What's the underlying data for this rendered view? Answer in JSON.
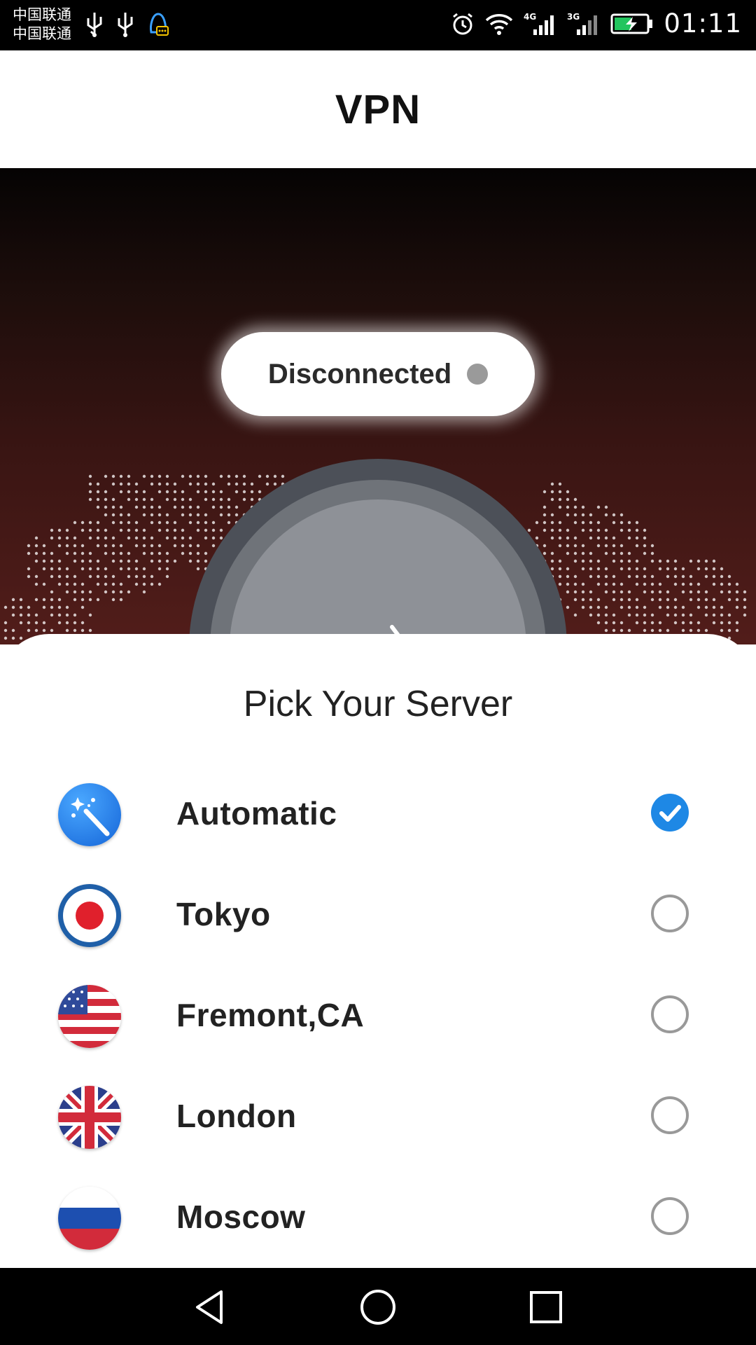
{
  "status_bar": {
    "carrier_1": "中国联通",
    "carrier_2": "中国联通",
    "time": "01:11",
    "icons_left": [
      "usb-icon",
      "usb-icon",
      "qq-notification-icon"
    ],
    "icons_right": [
      "alarm-icon",
      "wifi-icon",
      "signal-4g-icon",
      "signal-3g-icon",
      "battery-charging-icon"
    ]
  },
  "app_bar": {
    "title": "VPN"
  },
  "hero": {
    "status_text": "Disconnected",
    "status_color": "#9a9a9a",
    "power_icon": "power-icon"
  },
  "server_sheet": {
    "title": "Pick Your Server",
    "selected_index": 0,
    "servers": [
      {
        "name": "Automatic",
        "icon": "magic-wand-icon",
        "selected": true
      },
      {
        "name": "Tokyo",
        "icon": "japan-flag-icon",
        "selected": false
      },
      {
        "name": "Fremont,CA",
        "icon": "usa-flag-icon",
        "selected": false
      },
      {
        "name": "London",
        "icon": "uk-flag-icon",
        "selected": false
      },
      {
        "name": "Moscow",
        "icon": "russia-flag-icon",
        "selected": false
      }
    ]
  },
  "nav_bar": {
    "buttons": [
      "back-icon",
      "home-icon",
      "recents-icon"
    ]
  },
  "colors": {
    "accent": "#1e88e5",
    "hero_top": "#050303",
    "hero_bottom": "#521d1a"
  }
}
